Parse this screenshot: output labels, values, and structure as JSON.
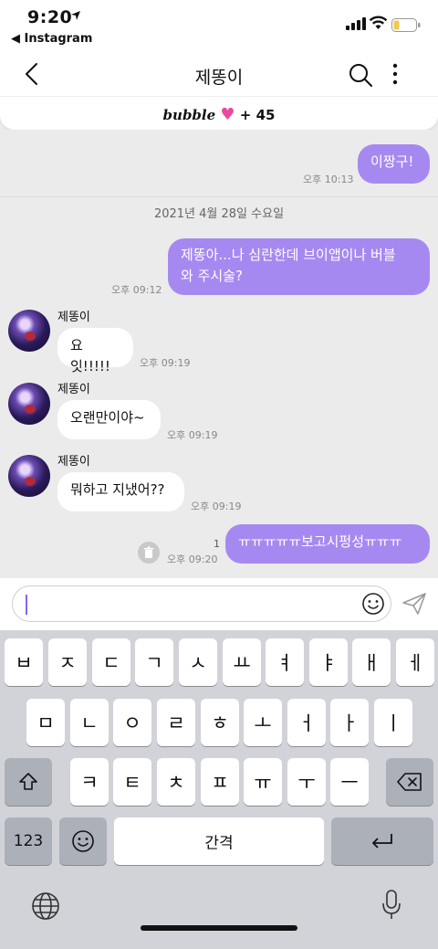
{
  "status": {
    "time": "9:20",
    "back_app": "◀ Instagram"
  },
  "nav": {
    "title": "제똥이"
  },
  "banner": {
    "brand": "bubble",
    "heart": "♥",
    "count": "+ 45"
  },
  "date_separator": "2021년 4월 28일 수요일",
  "messages": [
    {
      "dir": "out",
      "text": "이짱구!",
      "time": "오후 10:13"
    },
    {
      "dir": "out",
      "line1": "제똥아...나 심란한데 브이앱이나 버블",
      "line2": "와 주시술?",
      "time": "오후 09:12"
    },
    {
      "dir": "in",
      "sender": "제똥이",
      "text": "요잇!!!!!",
      "time": "오후 09:19"
    },
    {
      "dir": "in",
      "sender": "제똥이",
      "text": "오랜만이야~",
      "time": "오후 09:19"
    },
    {
      "dir": "in",
      "sender": "제똥이",
      "text": "뭐하고 지냈어??",
      "time": "오후 09:19"
    },
    {
      "dir": "out",
      "text": "ㅠㅠㅠㅠㅠ보고시펑성ㅠㅠㅠ",
      "time": "오후 09:20",
      "unread": "1"
    }
  ],
  "input": {
    "value": ""
  },
  "keyboard": {
    "row1": [
      "ㅂ",
      "ㅈ",
      "ㄷ",
      "ㄱ",
      "ㅅ",
      "ㅛ",
      "ㅕ",
      "ㅑ",
      "ㅐ",
      "ㅔ"
    ],
    "row2": [
      "ㅁ",
      "ㄴ",
      "ㅇ",
      "ㄹ",
      "ㅎ",
      "ㅗ",
      "ㅓ",
      "ㅏ",
      "ㅣ"
    ],
    "row3": [
      "ㅋ",
      "ㅌ",
      "ㅊ",
      "ㅍ",
      "ㅠ",
      "ㅜ",
      "ㅡ"
    ],
    "numbers": "123",
    "space": "간격"
  },
  "colors": {
    "accent": "#a689f0",
    "heart": "#e84aa0",
    "caret": "#8a62f0"
  }
}
